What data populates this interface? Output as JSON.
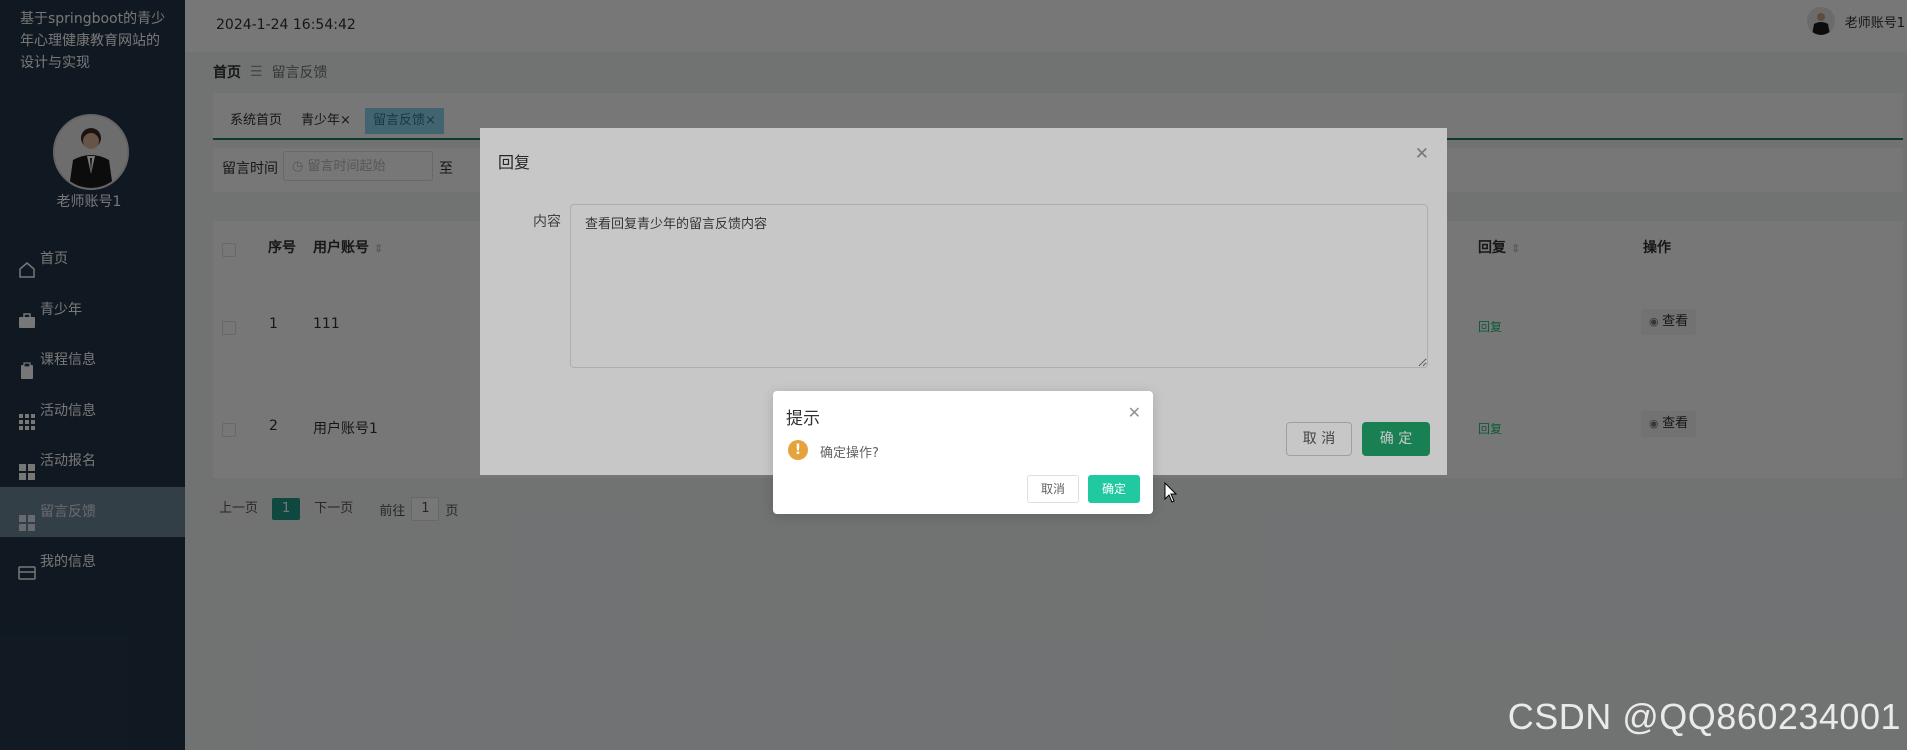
{
  "app": {
    "site_title": "基于springboot的青少年心理健康教育网站的设计与实现",
    "user_name": "老师账号1"
  },
  "header": {
    "datetime": "2024-1-24 16:54:42",
    "user_name": "老师账号1"
  },
  "sidebar": {
    "items": [
      {
        "label": "首页",
        "icon": "home-icon"
      },
      {
        "label": "青少年",
        "icon": "briefcase-icon"
      },
      {
        "label": "课程信息",
        "icon": "clipboard-icon"
      },
      {
        "label": "活动信息",
        "icon": "grid-icon"
      },
      {
        "label": "活动报名",
        "icon": "tiles-icon"
      },
      {
        "label": "留言反馈",
        "icon": "tiles-icon",
        "active": true
      },
      {
        "label": "我的信息",
        "icon": "card-icon"
      }
    ]
  },
  "breadcrumb": {
    "home": "首页",
    "separator": "☰",
    "current": "留言反馈"
  },
  "tabs": [
    {
      "label": "系统首页"
    },
    {
      "label": "青少年",
      "close": "×"
    },
    {
      "label": "留言反馈",
      "close": "×",
      "active": true
    }
  ],
  "filter": {
    "label": "留言时间",
    "start_placeholder": "留言时间起始",
    "to": "至"
  },
  "table": {
    "headers": {
      "index": "序号",
      "account": "用户账号",
      "reply": "回复",
      "actions": "操作"
    },
    "rows": [
      {
        "index": "1",
        "account": "111",
        "reply": "回复",
        "view": "查看"
      },
      {
        "index": "2",
        "account": "用户账号1",
        "reply": "回复",
        "view": "查看"
      }
    ]
  },
  "pagination": {
    "prev": "上一页",
    "current": "1",
    "next": "下一页",
    "goto_prefix": "前往",
    "goto_value": "1",
    "goto_suffix": "页"
  },
  "reply_dialog": {
    "title": "回复",
    "content_label": "内容",
    "content_value": "查看回复青少年的留言反馈内容",
    "cancel": "取 消",
    "ok": "确 定"
  },
  "confirm_box": {
    "title": "提示",
    "message": "确定操作?",
    "warn_icon": "!",
    "cancel": "取消",
    "ok": "确定"
  },
  "watermark": "CSDN @QQ860234001",
  "colors": {
    "sidebar_bg": "#243849",
    "accent": "#1f9b88",
    "ok_button": "#20c9a0",
    "reply_link": "#1fbf7a",
    "warning": "#e6a23c"
  }
}
